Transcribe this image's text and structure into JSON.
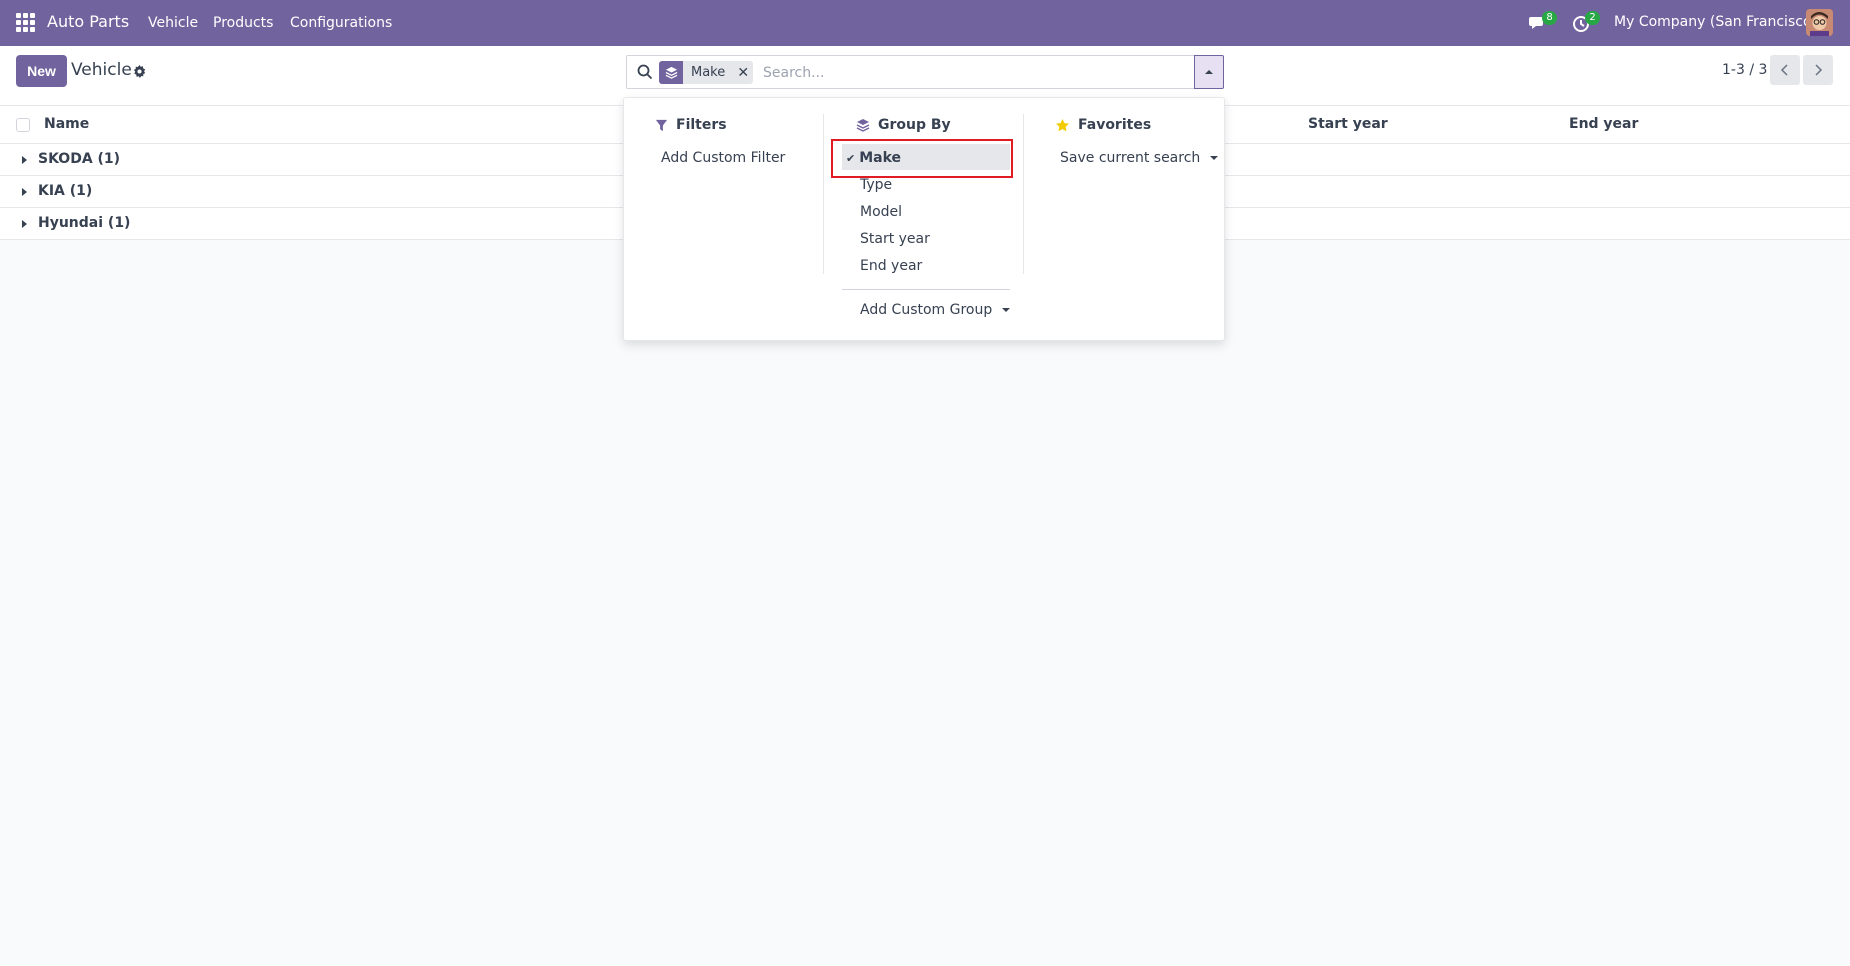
{
  "navbar": {
    "brand": "Auto Parts",
    "menu": [
      "Vehicle",
      "Products",
      "Configurations"
    ],
    "messages_count": "8",
    "activities_count": "2",
    "company": "My Company (San Francisco)"
  },
  "control": {
    "new_label": "New",
    "breadcrumb": "Vehicle",
    "facet_label": "Make",
    "search_placeholder": "Search...",
    "pager": "1-3 / 3"
  },
  "list": {
    "headers": {
      "name": "Name",
      "start_year": "Start year",
      "end_year": "End year"
    },
    "groups": [
      "SKODA (1)",
      "KIA (1)",
      "Hyundai (1)"
    ]
  },
  "dropdown": {
    "filters": {
      "title": "Filters",
      "add_custom": "Add Custom Filter"
    },
    "group_by": {
      "title": "Group By",
      "options": [
        "Make",
        "Type",
        "Model",
        "Start year",
        "End year"
      ],
      "selected": "Make",
      "add_custom": "Add Custom Group"
    },
    "favorites": {
      "title": "Favorites",
      "save_search": "Save current search"
    }
  },
  "colors": {
    "accent": "#71639e",
    "badge": "#28a745",
    "highlight": "#e01b24",
    "star": "#f3cc00"
  }
}
